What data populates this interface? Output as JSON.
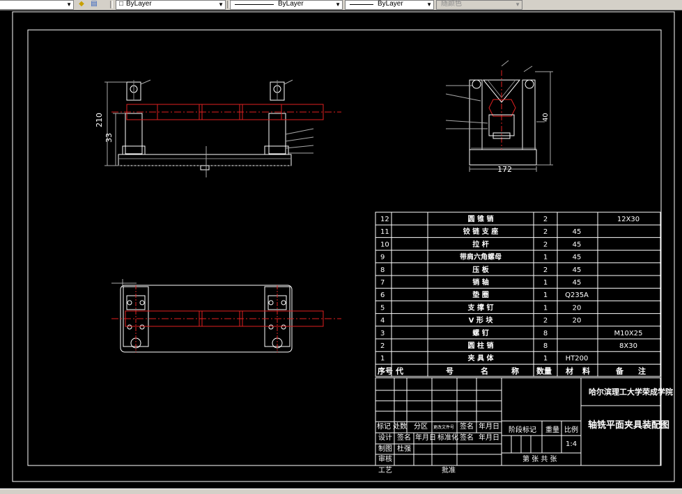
{
  "toolbar": {
    "layer_color": "ByLayer",
    "linetype": "ByLayer",
    "lineweight": "ByLayer",
    "plot_style": "随颜色"
  },
  "dims": {
    "height_total": "210",
    "height_sub": "33",
    "width_side": "172",
    "height_side": "40"
  },
  "bom": {
    "rows": [
      {
        "no": "12",
        "code": "",
        "name": "圆 锥 销",
        "qty": "2",
        "material": "",
        "note": "12X30"
      },
      {
        "no": "11",
        "code": "",
        "name": "铰 链 支 座",
        "qty": "2",
        "material": "45",
        "note": ""
      },
      {
        "no": "10",
        "code": "",
        "name": "拉  杆",
        "qty": "2",
        "material": "45",
        "note": ""
      },
      {
        "no": "9",
        "code": "",
        "name": "带肩六角螺母",
        "qty": "1",
        "material": "45",
        "note": ""
      },
      {
        "no": "8",
        "code": "",
        "name": "压  板",
        "qty": "2",
        "material": "45",
        "note": ""
      },
      {
        "no": "7",
        "code": "",
        "name": "销   轴",
        "qty": "1",
        "material": "45",
        "note": ""
      },
      {
        "no": "6",
        "code": "",
        "name": "垫   圈",
        "qty": "1",
        "material": "Q235A",
        "note": ""
      },
      {
        "no": "5",
        "code": "",
        "name": "支 撑 钉",
        "qty": "1",
        "material": "20",
        "note": ""
      },
      {
        "no": "4",
        "code": "",
        "name": "V 形 块",
        "qty": "2",
        "material": "20",
        "note": ""
      },
      {
        "no": "3",
        "code": "",
        "name": "螺   钉",
        "qty": "8",
        "material": "",
        "note": "M10X25"
      },
      {
        "no": "2",
        "code": "",
        "name": "圆 柱 销",
        "qty": "8",
        "material": "",
        "note": "8X30"
      },
      {
        "no": "1",
        "code": "",
        "name": "夹 具 体",
        "qty": "1",
        "material": "HT200",
        "note": ""
      }
    ],
    "headers": {
      "no": "序号",
      "code_a": "代",
      "code_b": "号",
      "name_a": "名",
      "name_b": "称",
      "qty": "数量",
      "material_a": "材",
      "material_b": "料",
      "note_a": "备",
      "note_b": "注"
    }
  },
  "title_block": {
    "school": "哈尔滨理工大学荣成学院",
    "drawing_title": "轴铣平面夹具装配图",
    "mark": "标记",
    "count": "处数",
    "zone": "分区",
    "change_doc": "更改文件号",
    "sign": "签名",
    "date": "年月日",
    "design": "设计",
    "sign2": "签名",
    "date2": "年月日",
    "standard": "标准化",
    "sign3": "签名",
    "date3": "年月日",
    "draw": "制图",
    "drafter": "杜强",
    "review": "审核",
    "process": "工艺",
    "approve": "批准",
    "stage": "阶段标记",
    "weight": "重量",
    "scale_label": "比例",
    "scale": "1:4",
    "sheets": "第 张  共 张"
  }
}
